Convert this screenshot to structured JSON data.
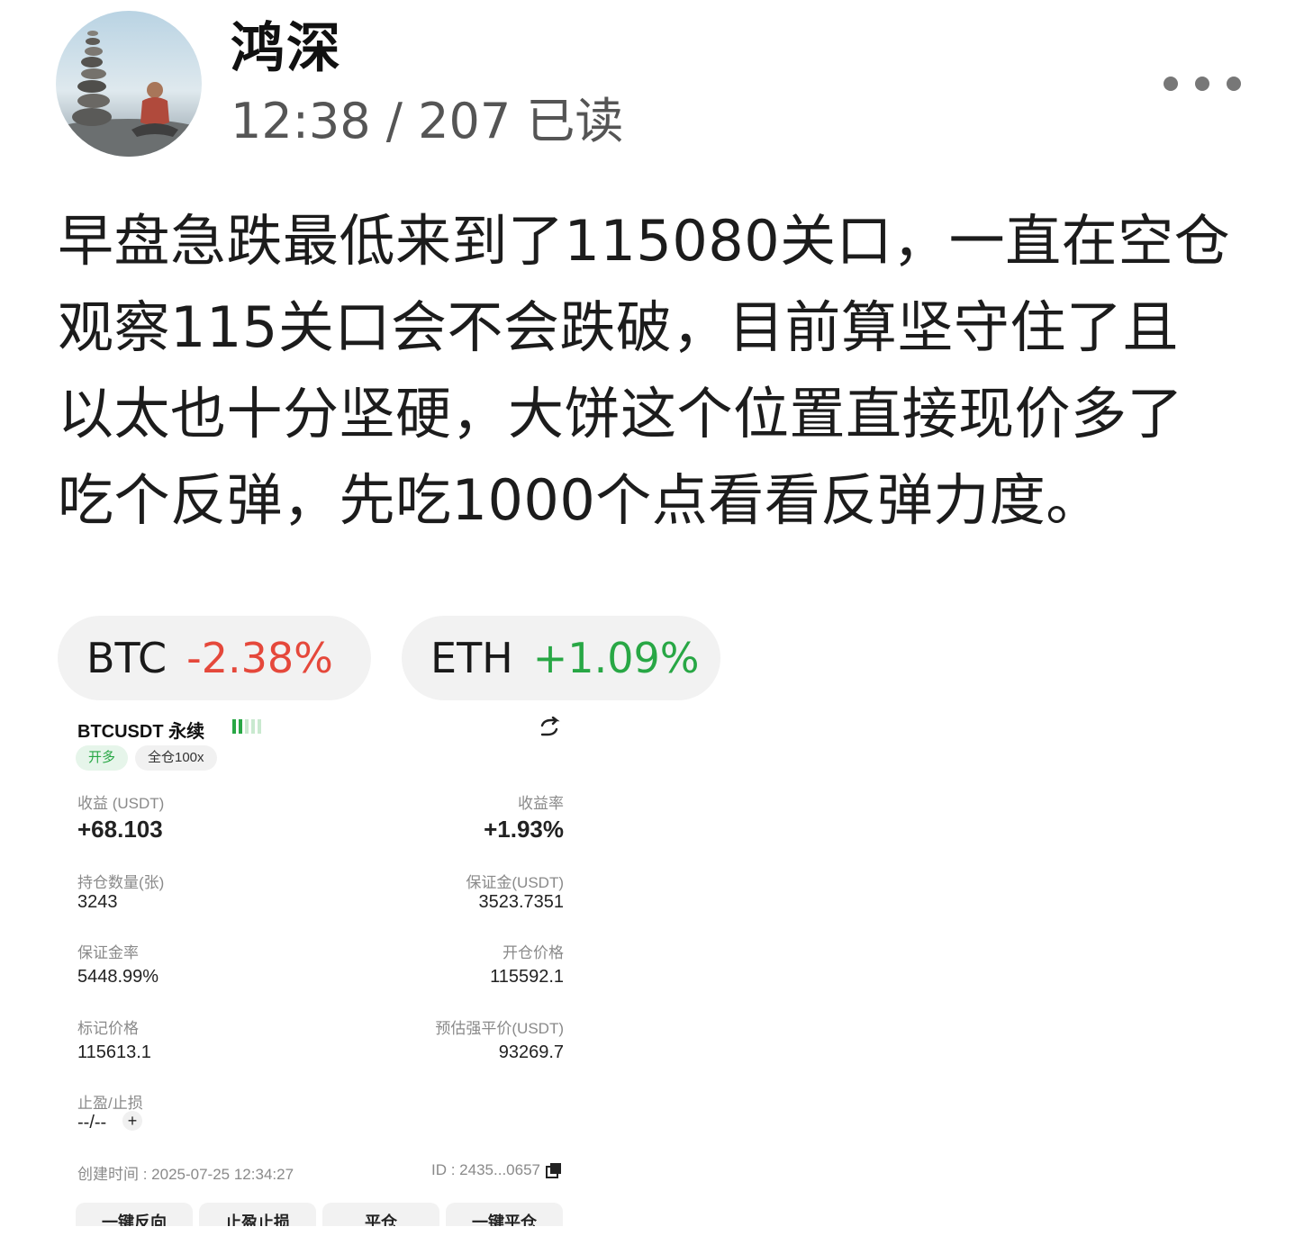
{
  "author": {
    "name": "鸿深",
    "meta": "12:38 / 207 已读"
  },
  "post": {
    "lines": [
      "早盘急跌最低来到了115080关口，一直在空仓",
      "观察115关口会不会跌破，目前算坚守住了且",
      "以太也十分坚硬，大饼这个位置直接现价多了",
      "吃个反弹，先吃1000个点看看反弹力度。"
    ]
  },
  "tags": [
    {
      "symbol": "BTC",
      "change": "-2.38%"
    },
    {
      "symbol": "ETH",
      "change": "+1.09%"
    }
  ],
  "card": {
    "title": "BTCUSDT 永续",
    "chip_side": "开多",
    "chip_mode": "全仓100x",
    "pnl_label": "收益 (USDT)",
    "pnl_value": "+68.103",
    "roi_label": "收益率",
    "roi_value": "+1.93%",
    "qty_label": "持仓数量(张)",
    "qty_value": "3243",
    "margin_label": "保证金(USDT)",
    "margin_value": "3523.7351",
    "margin_rate_label": "保证金率",
    "margin_rate_value": "5448.99%",
    "entry_label": "开仓价格",
    "entry_value": "115592.1",
    "mark_label": "标记价格",
    "mark_value": "115613.1",
    "liq_label": "预估强平价(USDT)",
    "liq_value": "93269.7",
    "tpsl_label": "止盈/止损",
    "tpsl_value": "--/--",
    "created": "创建时间 : 2025-07-25 12:34:27",
    "id": "ID : 2435...0657",
    "buttons": [
      "一键反向",
      "止盈止损",
      "平仓",
      "一键平仓"
    ]
  },
  "colors": {
    "negative": "#e5483b",
    "positive": "#28a745"
  }
}
